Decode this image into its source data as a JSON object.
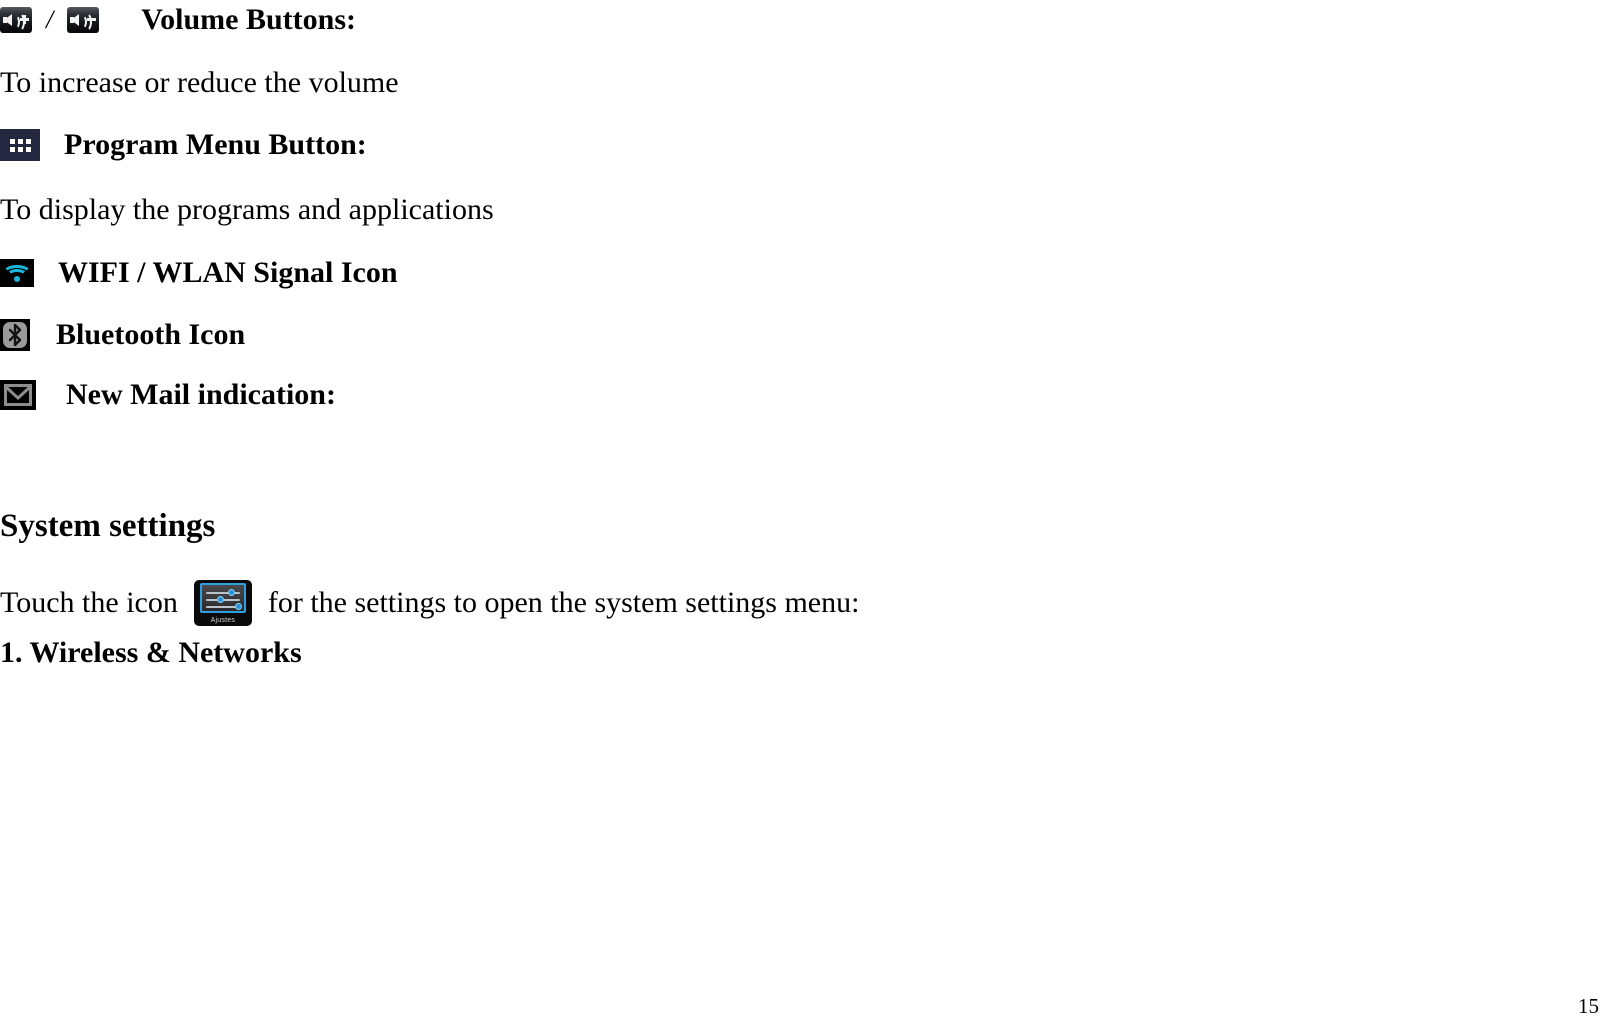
{
  "document": {
    "page_number": "15",
    "sections": [
      {
        "id": "volume",
        "icons": [
          "volume-up-icon",
          "volume-down-icon"
        ],
        "separator": "/",
        "caption": "Volume Buttons:",
        "description": "To increase or reduce the volume"
      },
      {
        "id": "program-menu",
        "icons": [
          "program-menu-icon"
        ],
        "caption": "Program Menu Button:",
        "description": "To display the programs and applications"
      },
      {
        "id": "wifi",
        "icons": [
          "wifi-signal-icon"
        ],
        "caption": "WIFI / WLAN Signal Icon",
        "description": ""
      },
      {
        "id": "bluetooth",
        "icons": [
          "bluetooth-icon"
        ],
        "caption": "Bluetooth Icon",
        "description": ""
      },
      {
        "id": "mail",
        "icons": [
          "mail-icon"
        ],
        "caption": "New Mail indication:",
        "description": ""
      }
    ],
    "system_settings": {
      "heading": "System settings",
      "instruction_before": "Touch the icon",
      "instruction_after": "for the settings to open the system settings menu:",
      "settings_icon_label": "Ajustes",
      "subheading": "1. Wireless & Networks"
    }
  },
  "colors": {
    "page_background": "#ffffff",
    "text": "#000000",
    "program_menu_icon_bg": "#232840",
    "wifi_accent": "#19b6d9",
    "settings_accent": "#2f9fe0",
    "icon_black": "#000000",
    "bluetooth_plate": "#9a9a9a"
  }
}
